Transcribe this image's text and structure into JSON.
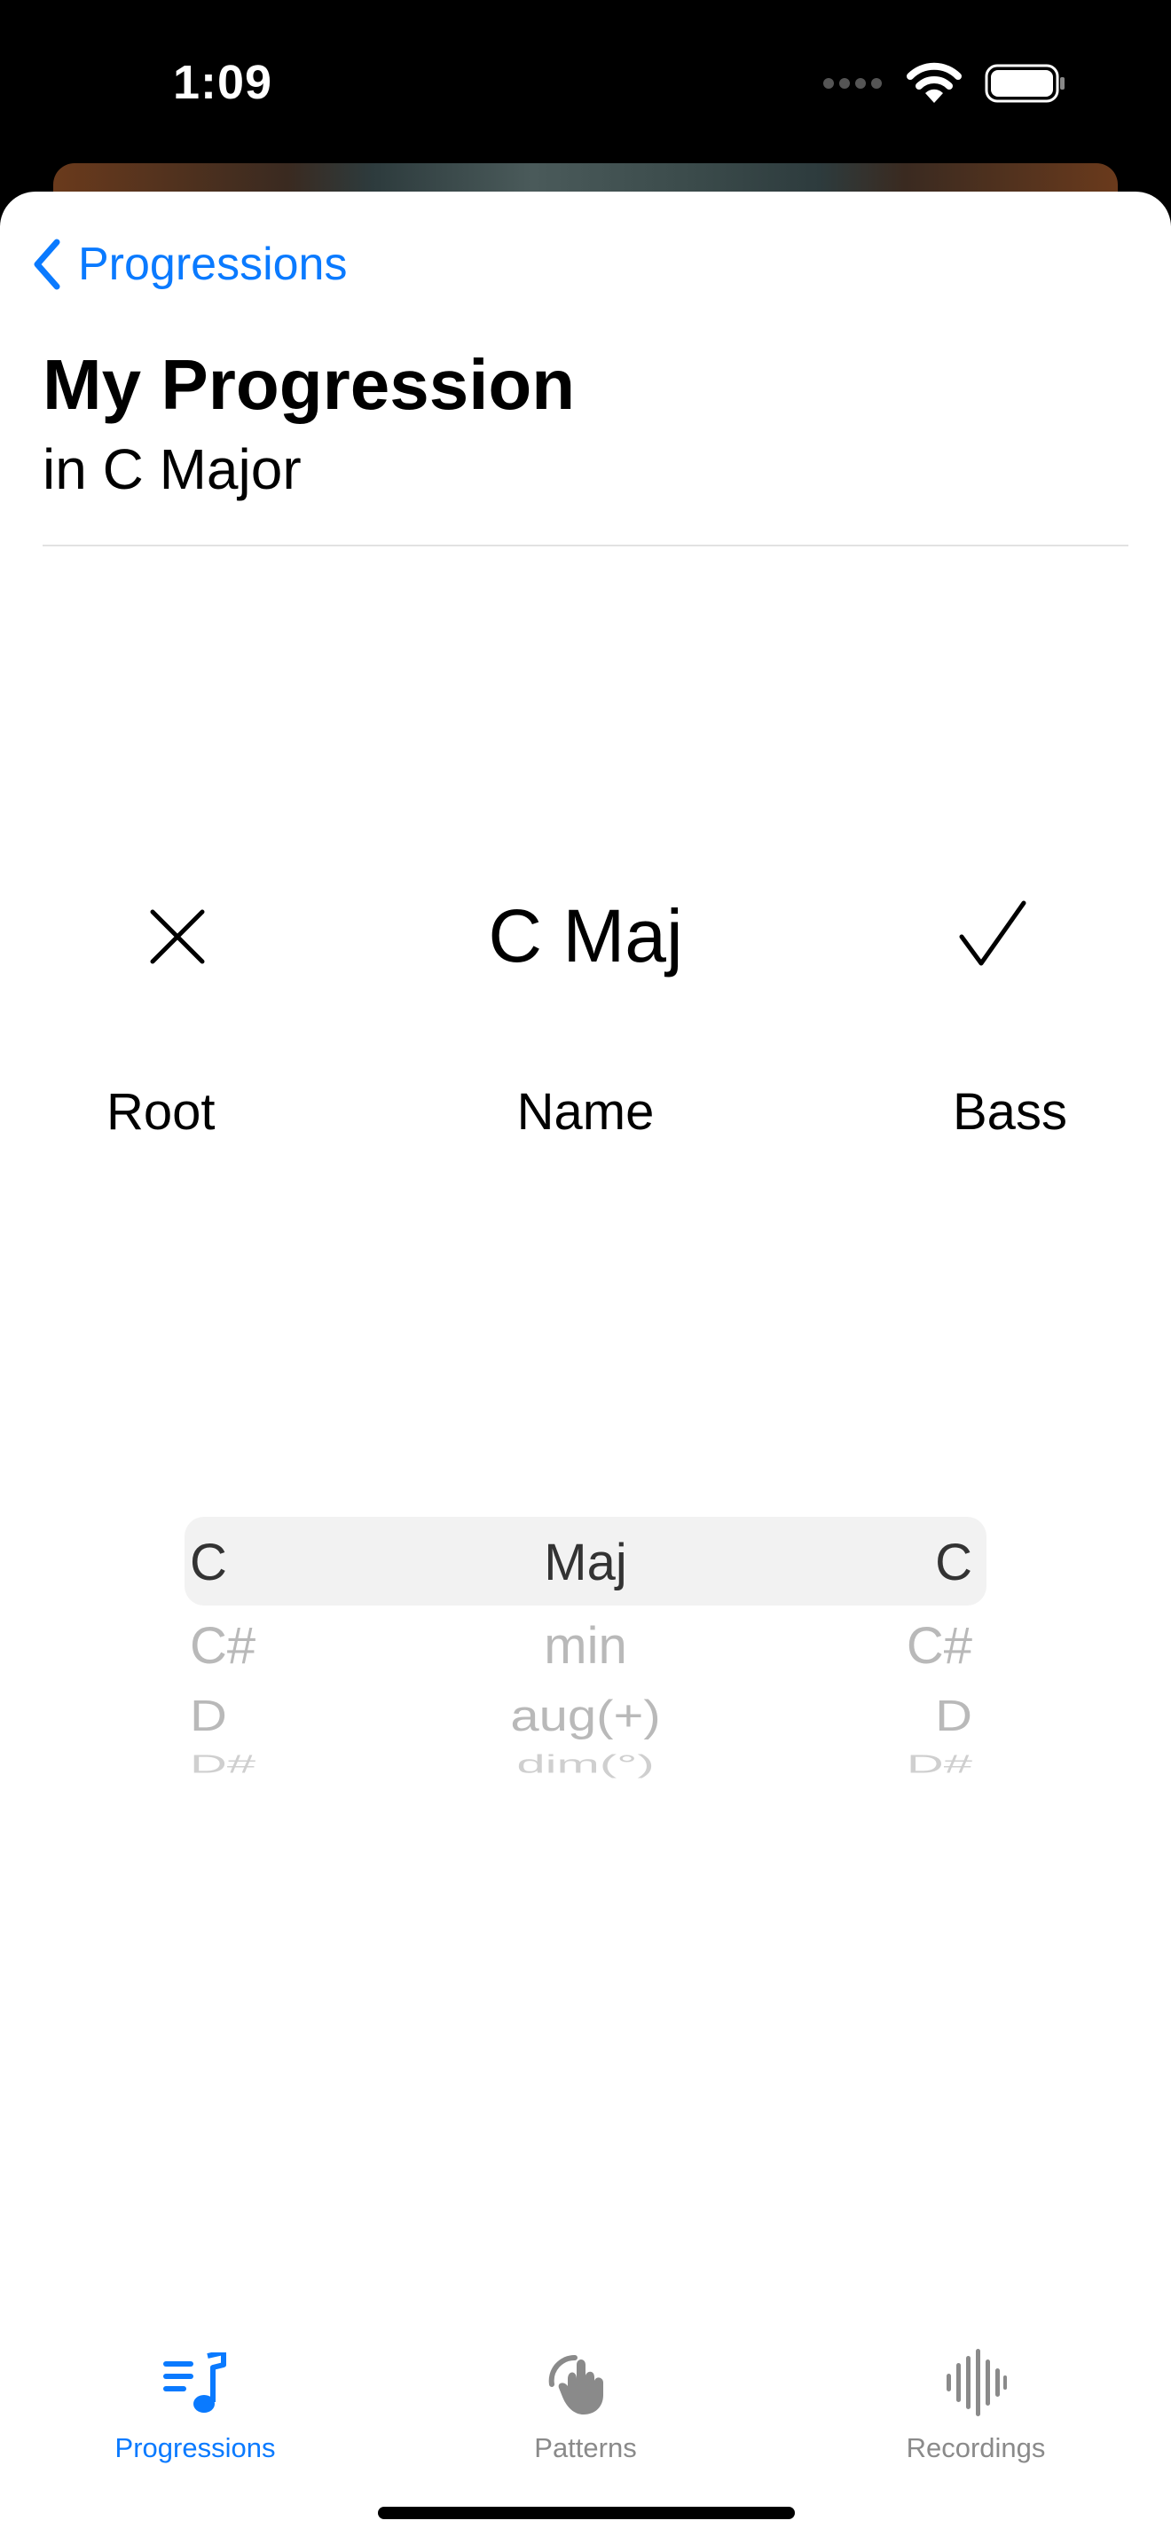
{
  "status": {
    "time": "1:09"
  },
  "nav": {
    "back_label": "Progressions"
  },
  "header": {
    "title": "My Progression",
    "subtitle": "in C Major"
  },
  "editor": {
    "chord_name": "C Maj",
    "columns": {
      "root": "Root",
      "name": "Name",
      "bass": "Bass"
    }
  },
  "picker": {
    "root": [
      "C",
      "C#",
      "D",
      "D#"
    ],
    "name": [
      "Maj",
      "min",
      "aug(+)",
      "dim(°)"
    ],
    "bass": [
      "C",
      "C#",
      "D",
      "D#"
    ]
  },
  "tabs": [
    {
      "label": "Progressions",
      "icon": "music-list-icon",
      "active": true
    },
    {
      "label": "Patterns",
      "icon": "hand-strum-icon",
      "active": false
    },
    {
      "label": "Recordings",
      "icon": "waveform-icon",
      "active": false
    }
  ],
  "colors": {
    "accent": "#0a7aff",
    "inactive": "#8a8a8a"
  }
}
